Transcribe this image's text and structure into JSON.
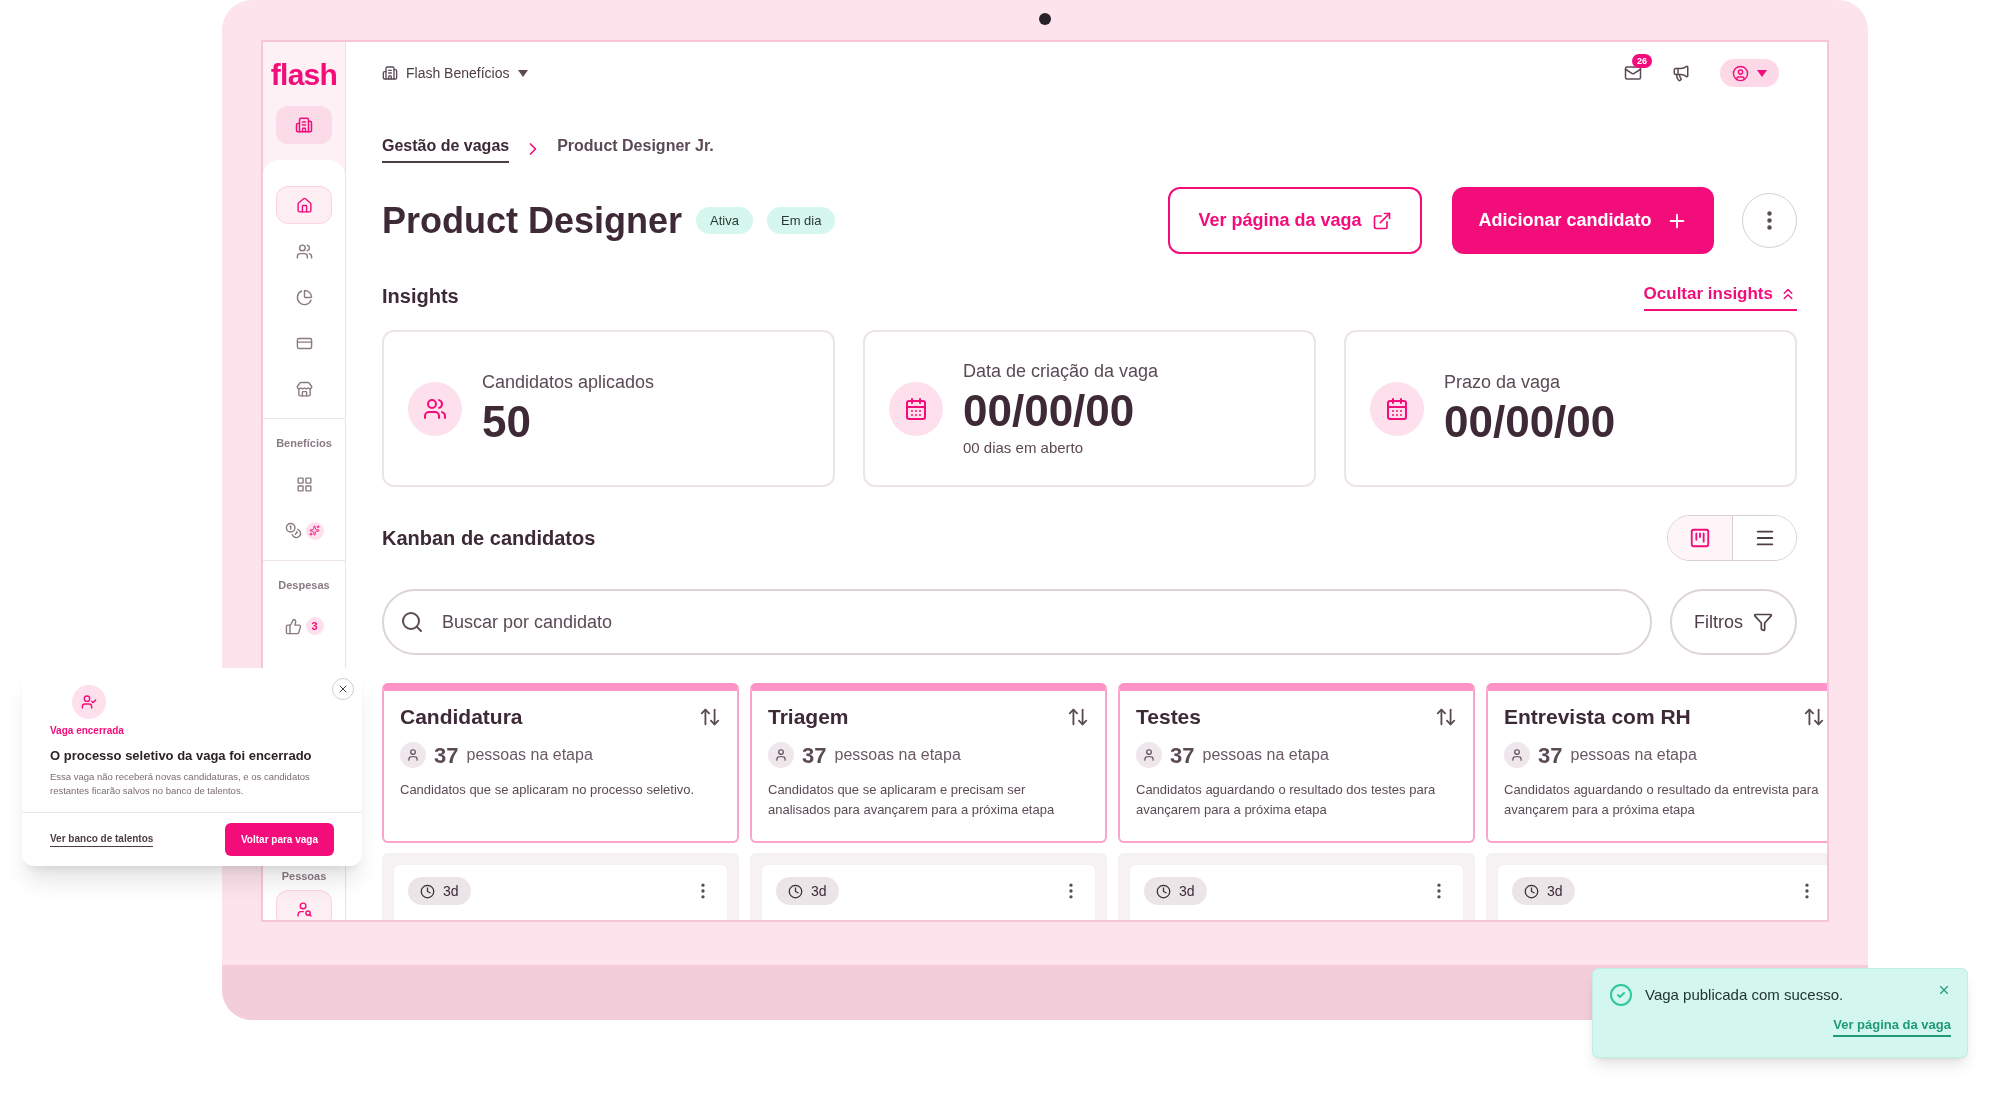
{
  "sidebar": {
    "logo": "flash",
    "groups": [
      {
        "items": [
          {
            "kind": "home",
            "selected": true
          },
          {
            "kind": "people",
            "selected": false
          },
          {
            "kind": "chart",
            "selected": false
          },
          {
            "kind": "card",
            "selected": false
          },
          {
            "kind": "store",
            "selected": false
          }
        ]
      },
      {
        "title": "Benefícios",
        "items": [
          {
            "kind": "grid",
            "selected": false
          },
          {
            "kind": "coins",
            "selected": false
          }
        ]
      },
      {
        "title": "Despesas",
        "items": [
          {
            "kind": "approvals",
            "selected": false,
            "badge": "3"
          }
        ]
      }
    ],
    "bottom_group": {
      "title": "Pessoas",
      "items": [
        {
          "kind": "recruiting",
          "selected": true
        }
      ]
    }
  },
  "top_bar": {
    "company": "Flash Benefícios",
    "mail_badge": "26"
  },
  "breadcrumb": [
    {
      "label": "Gestão de vagas",
      "selected": true
    },
    {
      "label": "Product Designer Jr.",
      "selected": false
    }
  ],
  "header": {
    "title": "Product Designer",
    "tags": [
      "Ativa",
      "Em dia"
    ],
    "secondary_button": "Ver página da vaga",
    "primary_button": "Adicionar candidato"
  },
  "insights": {
    "heading": "Insights",
    "toggle": "Ocultar insights",
    "cards": [
      {
        "kind": "people",
        "label": "Candidatos aplicados",
        "value": "50"
      },
      {
        "kind": "date",
        "label": "Data de criação da vaga",
        "value": "00/00/00",
        "note": "00 dias em aberto"
      },
      {
        "kind": "date",
        "label": "Prazo da vaga",
        "value": "00/00/00"
      }
    ]
  },
  "kanban": {
    "heading": "Kanban de candidatos",
    "views": [
      {
        "kind": "board",
        "selected": true
      },
      {
        "kind": "list",
        "selected": false
      }
    ],
    "search": {
      "placeholder": "Buscar por candidato"
    },
    "filter_button": "Filtros",
    "columns": [
      {
        "title": "Candidatura",
        "count": "37",
        "count_label": "pessoas na etapa",
        "description": "Candidatos que se aplicaram no processo seletivo.",
        "card_time": "3d"
      },
      {
        "title": "Triagem",
        "count": "37",
        "count_label": "pessoas na etapa",
        "description": "Candidatos que se aplicaram e precisam ser analisados para avançarem para a próxima etapa",
        "card_time": "3d"
      },
      {
        "title": "Testes",
        "count": "37",
        "count_label": "pessoas na etapa",
        "description": "Candidatos aguardando o resultado dos testes para avançarem para a próxima etapa",
        "card_time": "3d"
      },
      {
        "title": "Entrevista com RH",
        "count": "37",
        "count_label": "pessoas na etapa",
        "description": "Candidatos aguardando o resultado da entrevista para avançarem para a próxima etapa",
        "card_time": "3d"
      }
    ]
  },
  "modal": {
    "label": "Vaga encerrada",
    "title": "O processo seletivo da vaga foi encerrado",
    "body": "Essa vaga não receberá novas candidaturas, e os candidatos restantes ficarão salvos no banco de talentos.",
    "link": "Ver banco de talentos",
    "button": "Voltar para vaga"
  },
  "toast": {
    "message": "Vaga publicada com sucesso.",
    "link": "Ver página da vaga"
  }
}
